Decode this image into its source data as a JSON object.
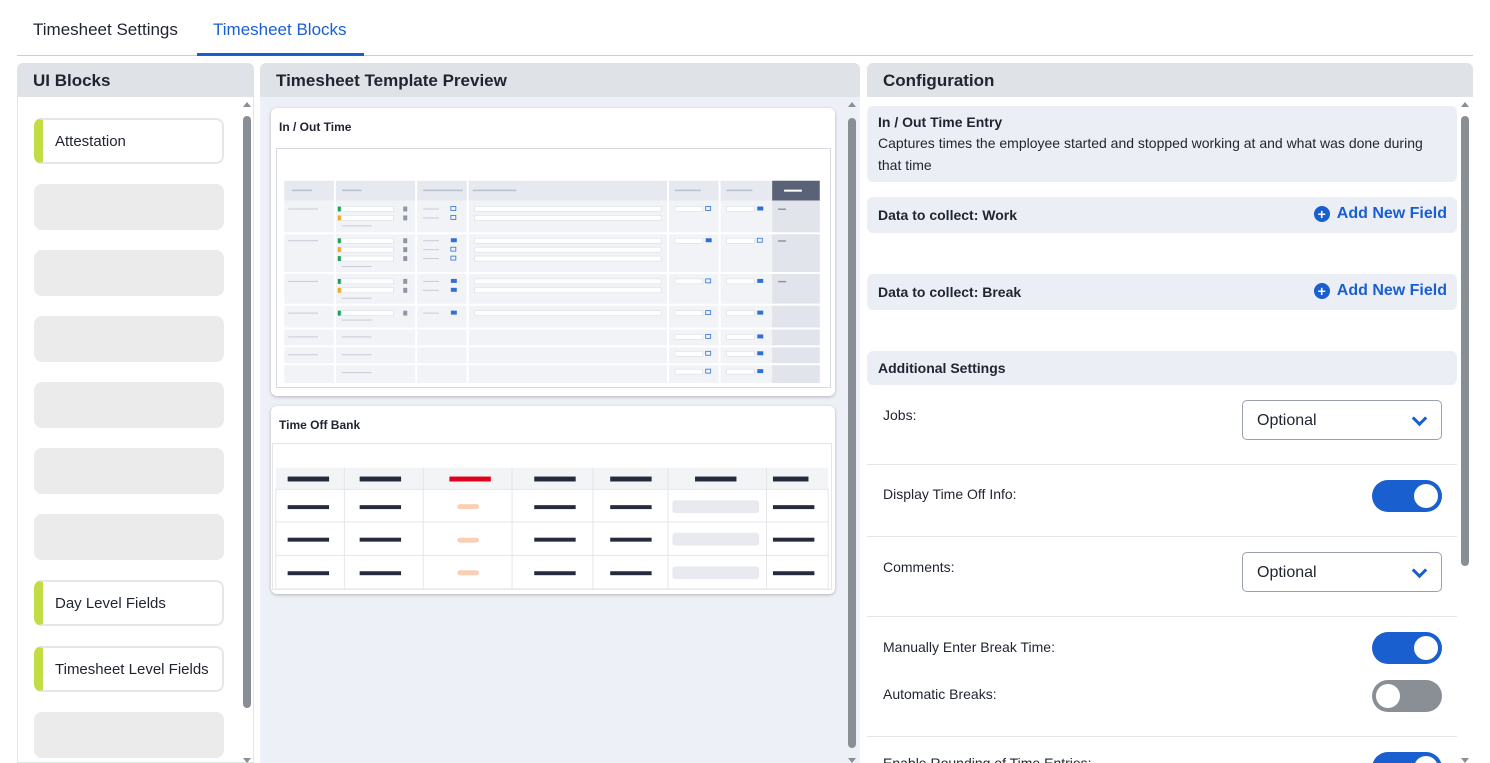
{
  "tabs": [
    {
      "label": "Timesheet Settings",
      "active": false
    },
    {
      "label": "Timesheet Blocks",
      "active": true
    }
  ],
  "panels": {
    "ui_blocks": {
      "title": "UI Blocks",
      "items": [
        {
          "label": "Attestation",
          "filled": true
        },
        {
          "label": "",
          "filled": false
        },
        {
          "label": "",
          "filled": false
        },
        {
          "label": "",
          "filled": false
        },
        {
          "label": "",
          "filled": false
        },
        {
          "label": "",
          "filled": false
        },
        {
          "label": "",
          "filled": false
        },
        {
          "label": "Day Level Fields",
          "filled": true
        },
        {
          "label": "Timesheet Level Fields",
          "filled": true
        },
        {
          "label": "",
          "filled": false
        }
      ]
    },
    "preview": {
      "title": "Timesheet Template Preview",
      "cards": [
        {
          "title": "In / Out Time"
        },
        {
          "title": "Time Off Bank"
        }
      ]
    },
    "configuration": {
      "title": "Configuration",
      "block_title": "In / Out Time Entry",
      "block_description": "Captures times the employee started and stopped working at and what was done during that time",
      "work_section": {
        "title": "Data to collect: Work",
        "add_label": "Add New Field"
      },
      "break_section": {
        "title": "Data to collect: Break",
        "add_label": "Add New Field"
      },
      "additional": {
        "title": "Additional Settings",
        "jobs": {
          "label": "Jobs:",
          "value": "Optional"
        },
        "display_time_off": {
          "label": "Display Time Off Info:",
          "on": true
        },
        "comments": {
          "label": "Comments:",
          "value": "Optional"
        },
        "manual_break": {
          "label": "Manually Enter Break Time:",
          "on": true
        },
        "auto_breaks": {
          "label": "Automatic Breaks:",
          "on": false
        },
        "partial_label": "Enable Rounding of Time Entries:"
      }
    }
  },
  "colors": {
    "accent": "#1a5fd0",
    "block_marker": "#c2dc45",
    "highlight_red": "#e0001b"
  }
}
